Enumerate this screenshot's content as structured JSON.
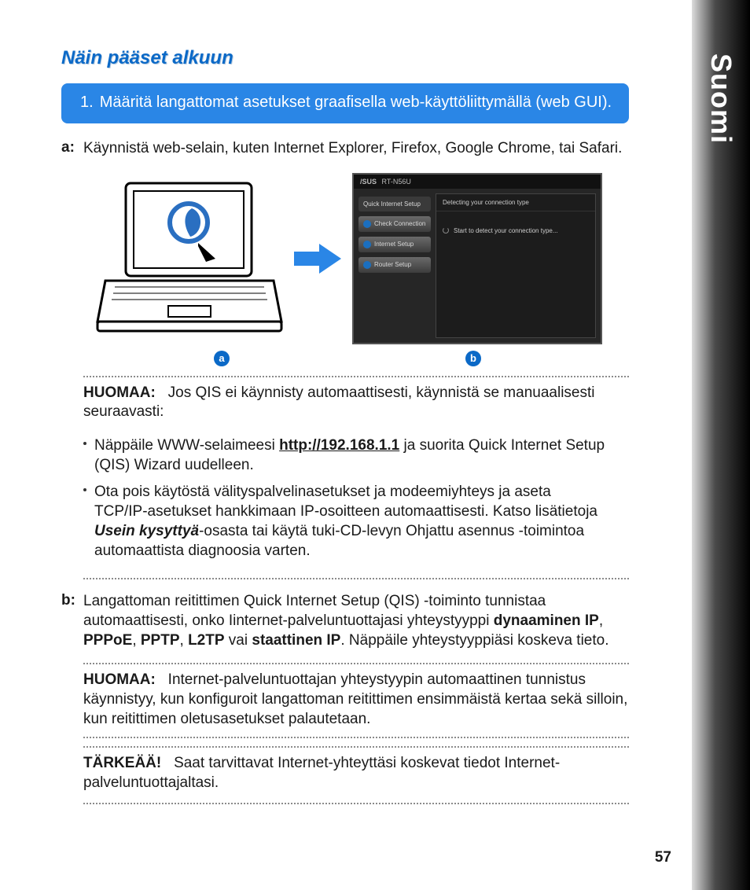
{
  "sideTab": "Suomi",
  "heading": "Näin pääset alkuun",
  "step1": {
    "num": "1.",
    "text": "Määritä langattomat asetukset graafisella web-käyttöliittymällä (web GUI)."
  },
  "a": {
    "label": "a:",
    "text": "Käynnistä web-selain, kuten Internet Explorer, Firefox, Google Chrome, tai Safari."
  },
  "router": {
    "brand": "/SUS",
    "model": "RT-N56U",
    "side0": "Quick Internet Setup",
    "side1": "Check Connection",
    "side2": "Internet Setup",
    "side3": "Router Setup",
    "mainHdr": "Detecting your connection type",
    "mainBody": "Start to detect your connection type..."
  },
  "badges": {
    "a": "a",
    "b": "b"
  },
  "note1": {
    "label": "HUOMAA:",
    "text": "Jos QIS ei käynnisty automaattisesti, käynnistä se manuaalisesti seuraavasti:"
  },
  "bullet1": {
    "pre": "Näppäile WWW-selaimeesi ",
    "url": "http://192.168.1.1",
    "post": " ja suorita Quick Internet Setup (QIS) Wizard uudelleen."
  },
  "bullet2": {
    "line1": "Ota pois käytöstä välityspalvelinasetukset ja modeemiyhteys ja aseta",
    "line2a": "TCP/IP-asetukset hankkimaan IP-osoitteen automaattisesti. Katso lisätietoja ",
    "faq": "Usein kysyttyä",
    "line2b": "-osasta tai käytä tuki-CD-levyn Ohjattu asennus -toimintoa automaattista diagnoosia varten."
  },
  "b": {
    "label": "b:",
    "pre": "Langattoman reitittimen Quick Internet Setup (QIS) -toiminto tunnistaa automaattisesti, onko Iinternet-palveluntuottajasi yhteystyyppi ",
    "t1": "dynaaminen IP",
    "sep1": ", ",
    "t2": "PPPoE",
    "sep2": ", ",
    "t3": "PPTP",
    "sep3": ", ",
    "t4": "L2TP",
    "sep4": " vai ",
    "t5": "staattinen IP",
    "post": ". Näppäile yhteystyyppiäsi koskeva tieto."
  },
  "note2": {
    "label": "HUOMAA:",
    "text": "Internet-palveluntuottajan yhteystyypin automaattinen tunnistus käynnistyy, kun konfiguroit langattoman reitittimen ensimmäistä kertaa sekä silloin, kun reitittimen oletusasetukset palautetaan."
  },
  "important": {
    "label": "TÄRKEÄÄ!",
    "text": "Saat tarvittavat Internet-yhteyttäsi koskevat tiedot Internet-palveluntuottajaltasi."
  },
  "pageNum": "57"
}
